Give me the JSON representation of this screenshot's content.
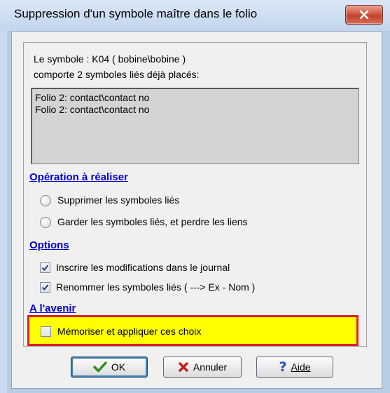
{
  "window": {
    "title": "Suppression d'un symbole maître dans le folio",
    "close_icon": "close-x-icon"
  },
  "info": {
    "line1": "Le symbole :  K04 ( bobine\\bobine )",
    "line2": "comporte 2 symboles liés déjà placés:"
  },
  "linked_list": {
    "items": [
      "Folio 2: contact\\contact no",
      "Folio 2: contact\\contact no"
    ]
  },
  "operation": {
    "heading": "Opération à réaliser",
    "options": [
      {
        "label": "Supprimer les symboles liés",
        "selected": false
      },
      {
        "label": "Garder les symboles liés, et perdre les liens",
        "selected": false
      }
    ]
  },
  "options_section": {
    "heading": "Options",
    "checks": [
      {
        "label": "Inscrire les modifications dans le journal",
        "checked": true
      },
      {
        "label": "Renommer les symboles liés ( ---> Ex - Nom )",
        "checked": true
      }
    ]
  },
  "future": {
    "heading": "A l'avenir",
    "remember_label": "Mémoriser et appliquer ces choix",
    "remember_checked": false
  },
  "buttons": {
    "ok": "OK",
    "cancel": "Annuler",
    "help": "Aide"
  },
  "colors": {
    "highlight_fill": "#ffff00",
    "highlight_border": "#e0202a",
    "section_heading": "#0000cc"
  }
}
